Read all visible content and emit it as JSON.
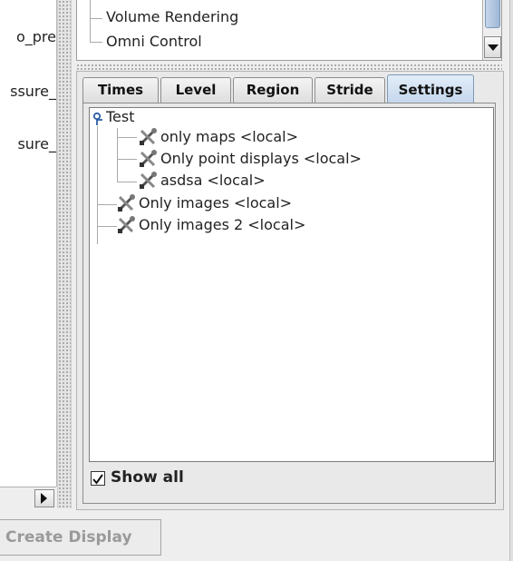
{
  "left_list": {
    "items": [
      "o_pre",
      "ssure_",
      "sure_"
    ]
  },
  "top_tree": {
    "items": [
      "Volume Rendering",
      "Omni Control"
    ]
  },
  "tabs": [
    {
      "label": "Times",
      "active": false
    },
    {
      "label": "Level",
      "active": false
    },
    {
      "label": "Region",
      "active": false
    },
    {
      "label": "Stride",
      "active": false
    },
    {
      "label": "Settings",
      "active": true
    }
  ],
  "settings_tree": {
    "root": {
      "label": "Test",
      "icon": "pin-icon"
    },
    "group_items": [
      {
        "label": "only maps <local>",
        "icon": "tools-icon"
      },
      {
        "label": "Only point displays <local>",
        "icon": "tools-icon"
      },
      {
        "label": "asdsa <local>",
        "icon": "tools-icon"
      }
    ],
    "top_items": [
      {
        "label": "Only images <local>",
        "icon": "tools-icon"
      },
      {
        "label": "Only images 2 <local>",
        "icon": "tools-icon"
      }
    ]
  },
  "show_all": {
    "label": "Show all",
    "checked": true
  },
  "create_display": {
    "label": "Create Display",
    "enabled": false
  },
  "colors": {
    "tab_active": "#c4d6ec",
    "disabled_text": "#9a9a9a"
  }
}
